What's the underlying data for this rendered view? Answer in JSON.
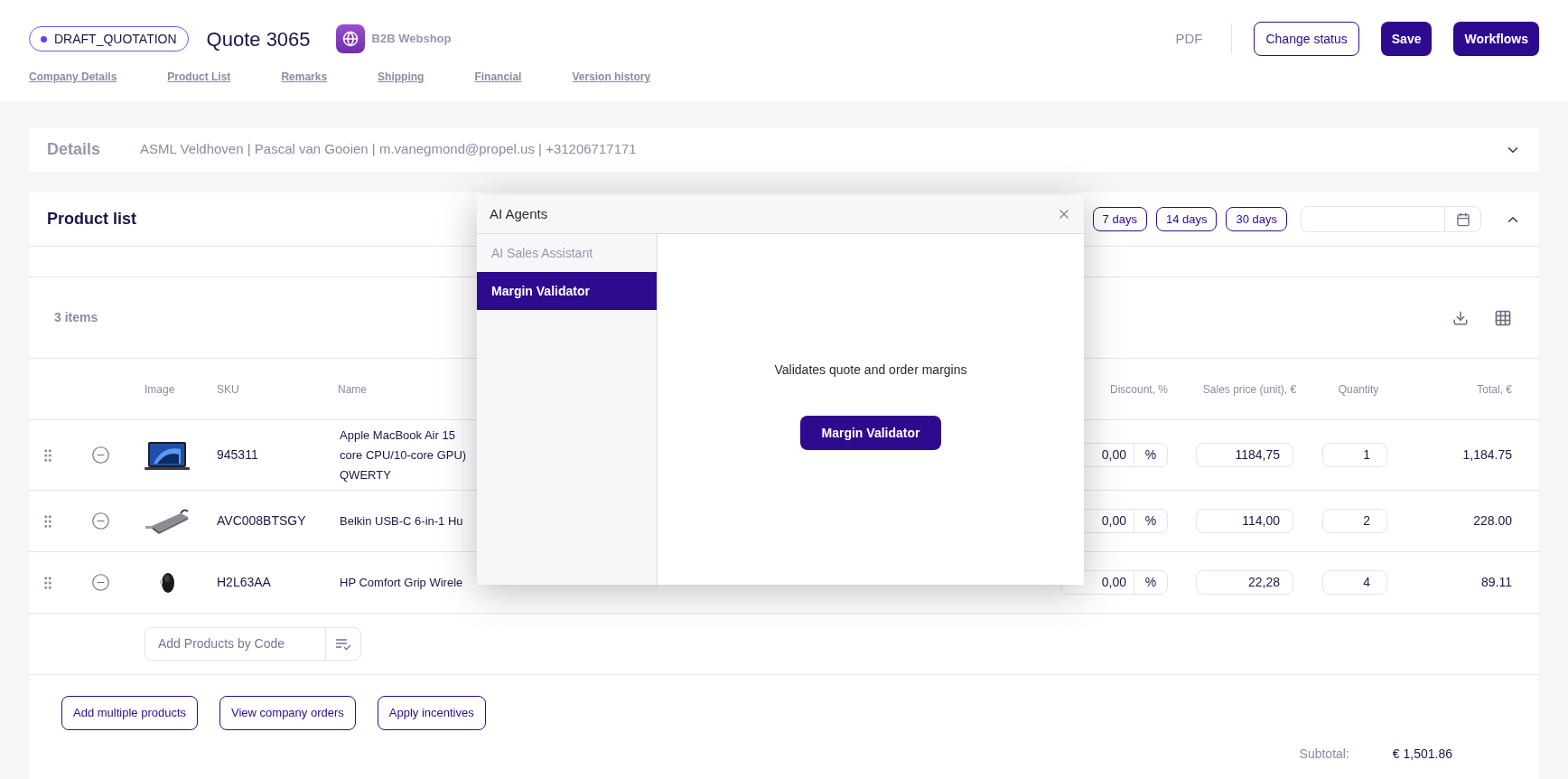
{
  "header": {
    "status": "DRAFT_QUOTATION",
    "title": "Quote 3065",
    "channel": "B2B Webshop",
    "actions": [
      {
        "label": "PDF",
        "kind": "text"
      },
      {
        "label": "Change status",
        "kind": "outline"
      },
      {
        "label": "Save",
        "kind": "primary"
      },
      {
        "label": "Workflows",
        "kind": "primary"
      }
    ]
  },
  "nav": [
    "Company Details",
    "Product List",
    "Remarks",
    "Shipping",
    "Financial",
    "Version history"
  ],
  "details": {
    "title": "Details",
    "summary": "ASML Veldhoven | Pascal van Gooien | m.vanegmond@propel.us | +31206717171"
  },
  "product_list": {
    "title": "Product list",
    "periods": [
      "7 days",
      "14 days",
      "30 days"
    ],
    "count": "3 items",
    "columns": [
      "Image",
      "SKU",
      "Name",
      "Discount, %",
      "Sales price (unit), €",
      "Quantity",
      "Total, €"
    ],
    "rows": [
      {
        "sku": "945311",
        "name_lines": [
          "Apple MacBook Air 15",
          "core CPU/10-core GPU)",
          "QWERTY"
        ],
        "discount": "0,00",
        "unit": "%",
        "price": "1184,75",
        "quantity": "1",
        "total": "1,184.75"
      },
      {
        "sku": "AVC008BTSGY",
        "name_lines": [
          "Belkin USB-C 6-in-1 Hu"
        ],
        "discount": "0,00",
        "unit": "%",
        "price": "114,00",
        "quantity": "2",
        "total": "228.00"
      },
      {
        "sku": "H2L63AA",
        "name_lines": [
          "HP Comfort Grip Wirele"
        ],
        "discount": "0,00",
        "unit": "%",
        "price": "22,28",
        "quantity": "4",
        "total": "89.11"
      }
    ],
    "add_placeholder": "Add Products by Code",
    "buttons": [
      "Add multiple products",
      "View company orders",
      "Apply incentives"
    ],
    "subtotal_label": "Subtotal:",
    "subtotal": "€ 1,501.86"
  },
  "modal": {
    "title": "AI Agents",
    "agents": [
      {
        "label": "AI Sales Assistant",
        "selected": false
      },
      {
        "label": "Margin Validator",
        "selected": true
      }
    ],
    "description": "Validates quote and order margins",
    "action": "Margin Validator"
  }
}
